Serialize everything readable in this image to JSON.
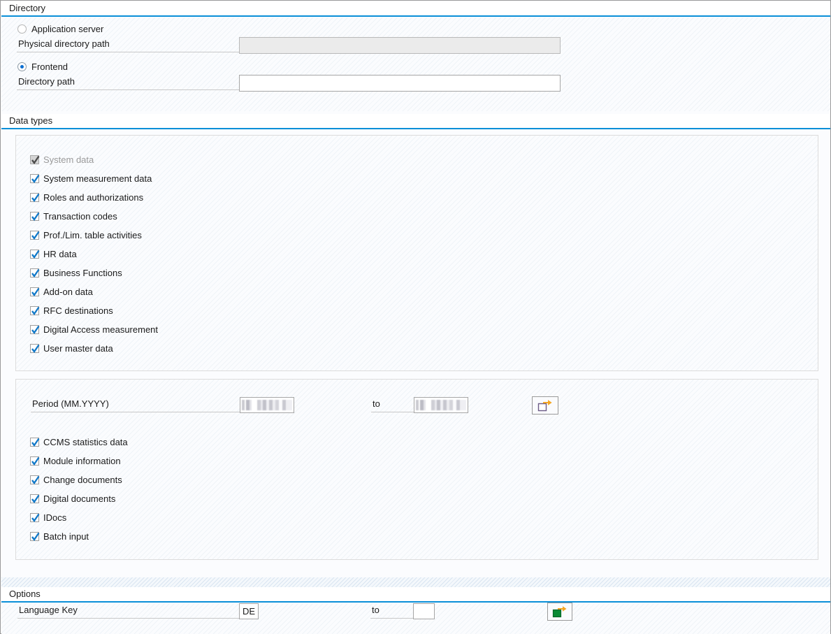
{
  "sections": {
    "directory": {
      "title": "Directory",
      "radios": [
        {
          "label": "Application server",
          "selected": false
        },
        {
          "label": "Frontend",
          "selected": true
        }
      ],
      "fields": [
        {
          "label": "Physical directory path",
          "value": "",
          "disabled": true
        },
        {
          "label": "Directory path",
          "value": "",
          "disabled": false
        }
      ]
    },
    "data_types": {
      "title": "Data types",
      "checkboxes": [
        {
          "label": "System data",
          "checked": true,
          "disabled": true
        },
        {
          "label": "System measurement data",
          "checked": true,
          "disabled": false
        },
        {
          "label": "Roles and authorizations",
          "checked": true,
          "disabled": false
        },
        {
          "label": "Transaction codes",
          "checked": true,
          "disabled": false
        },
        {
          "label": "Prof./Lim. table activities",
          "checked": true,
          "disabled": false
        },
        {
          "label": "HR data",
          "checked": true,
          "disabled": false
        },
        {
          "label": "Business Functions",
          "checked": true,
          "disabled": false
        },
        {
          "label": "Add-on data",
          "checked": true,
          "disabled": false
        },
        {
          "label": "RFC destinations",
          "checked": true,
          "disabled": false
        },
        {
          "label": "Digital Access measurement",
          "checked": true,
          "disabled": false
        },
        {
          "label": "User master data",
          "checked": true,
          "disabled": false
        }
      ],
      "period": {
        "label": "Period (MM.YYYY)",
        "from_value": "",
        "to_label": "to",
        "to_value": "",
        "multi_select_icon": "multi-selection-icon"
      },
      "checkboxes2": [
        {
          "label": "CCMS statistics data",
          "checked": true,
          "disabled": false
        },
        {
          "label": "Module information",
          "checked": true,
          "disabled": false
        },
        {
          "label": "Change documents",
          "checked": true,
          "disabled": false
        },
        {
          "label": "Digital documents",
          "checked": true,
          "disabled": false
        },
        {
          "label": "IDocs",
          "checked": true,
          "disabled": false
        },
        {
          "label": "Batch input",
          "checked": true,
          "disabled": false
        }
      ]
    },
    "options": {
      "title": "Options",
      "language_key": {
        "label": "Language Key",
        "from_value": "DE",
        "to_label": "to",
        "to_value": "",
        "multi_select_icon": "multi-selection-active-icon"
      }
    }
  },
  "colors": {
    "accent": "#0a8fd8",
    "check": "#1078c8",
    "radio_dot": "#0a6ed1",
    "icon_orange": "#f0a000",
    "icon_green": "#0a8a34",
    "field_border": "#a6a6a6",
    "disabled_bg": "#ebebeb"
  }
}
